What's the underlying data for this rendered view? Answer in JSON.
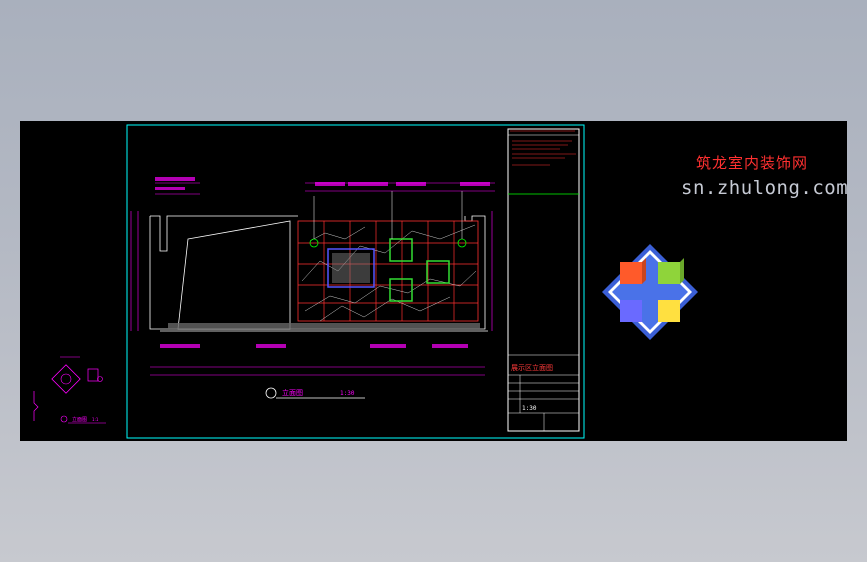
{
  "colors": {
    "background": "#000000",
    "frame": "#00ffff",
    "dimension": "#ff00ff",
    "wall_grid": "#ff3030",
    "niche_green": "#33dd33",
    "niche_blue": "#5555ff",
    "title_block_text": "#ff3030",
    "watermark_red": "#ff2020",
    "watermark_grey": "#c6cad4"
  },
  "drawing": {
    "elevation_title": "立面图",
    "elevation_scale": "1:30",
    "legend_title": "立面图",
    "legend_scale": "1:1",
    "note_line": "XX"
  },
  "title_block": {
    "sheet_title": "展示区立面图",
    "scale": "1:30",
    "sheet_number": " "
  },
  "watermark": {
    "brand": "筑龙室内装饰网",
    "url": "sn.zhulong.com",
    "logo_colors": [
      "#ff5a2a",
      "#8fd43a",
      "#ffe040",
      "#6a6aff"
    ]
  }
}
